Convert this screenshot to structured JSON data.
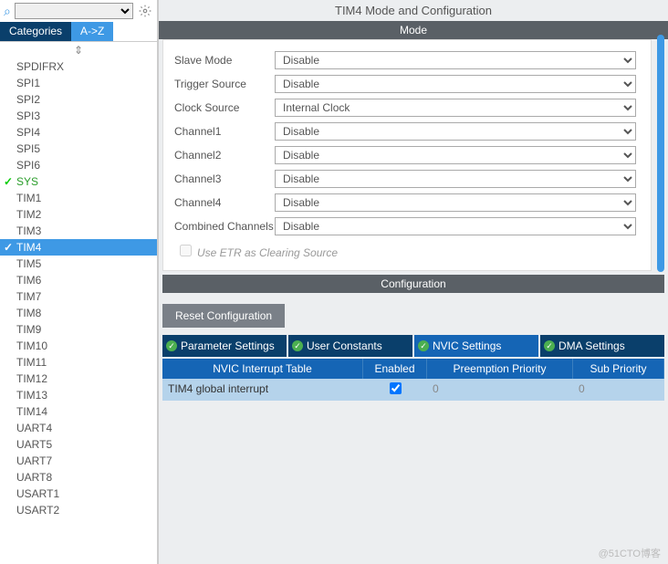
{
  "search": {
    "placeholder": ""
  },
  "tabs": {
    "categories": "Categories",
    "az": "A->Z"
  },
  "sidebar": {
    "items": [
      {
        "label": "SPDIFRX",
        "checked": false
      },
      {
        "label": "SPI1",
        "checked": false
      },
      {
        "label": "SPI2",
        "checked": false
      },
      {
        "label": "SPI3",
        "checked": false
      },
      {
        "label": "SPI4",
        "checked": false
      },
      {
        "label": "SPI5",
        "checked": false
      },
      {
        "label": "SPI6",
        "checked": false
      },
      {
        "label": "SYS",
        "checked": true
      },
      {
        "label": "TIM1",
        "checked": false
      },
      {
        "label": "TIM2",
        "checked": false
      },
      {
        "label": "TIM3",
        "checked": false
      },
      {
        "label": "TIM4",
        "checked": true,
        "selected": true
      },
      {
        "label": "TIM5",
        "checked": false
      },
      {
        "label": "TIM6",
        "checked": false
      },
      {
        "label": "TIM7",
        "checked": false
      },
      {
        "label": "TIM8",
        "checked": false
      },
      {
        "label": "TIM9",
        "checked": false
      },
      {
        "label": "TIM10",
        "checked": false
      },
      {
        "label": "TIM11",
        "checked": false
      },
      {
        "label": "TIM12",
        "checked": false
      },
      {
        "label": "TIM13",
        "checked": false
      },
      {
        "label": "TIM14",
        "checked": false
      },
      {
        "label": "UART4",
        "checked": false
      },
      {
        "label": "UART5",
        "checked": false
      },
      {
        "label": "UART7",
        "checked": false
      },
      {
        "label": "UART8",
        "checked": false
      },
      {
        "label": "USART1",
        "checked": false
      },
      {
        "label": "USART2",
        "checked": false
      }
    ]
  },
  "right": {
    "title": "TIM4 Mode and Configuration",
    "mode_header": "Mode",
    "config_header": "Configuration",
    "rows": [
      {
        "label": "Slave Mode",
        "value": "Disable"
      },
      {
        "label": "Trigger Source",
        "value": "Disable"
      },
      {
        "label": "Clock Source",
        "value": "Internal Clock"
      },
      {
        "label": "Channel1",
        "value": "Disable"
      },
      {
        "label": "Channel2",
        "value": "Disable"
      },
      {
        "label": "Channel3",
        "value": "Disable"
      },
      {
        "label": "Channel4",
        "value": "Disable"
      },
      {
        "label": "Combined Channels",
        "value": "Disable"
      }
    ],
    "etr": "Use ETR as Clearing Source",
    "reset": "Reset Configuration",
    "subtabs": {
      "param": "Parameter Settings",
      "user": "User Constants",
      "nvic": "NVIC Settings",
      "dma": "DMA Settings"
    },
    "nvic": {
      "h1": "NVIC Interrupt Table",
      "h2": "Enabled",
      "h3": "Preemption Priority",
      "h4": "Sub Priority",
      "rows": [
        {
          "name": "TIM4 global interrupt",
          "enabled": true,
          "preempt": "0",
          "sub": "0"
        }
      ]
    }
  },
  "watermark": "@51CTO博客"
}
